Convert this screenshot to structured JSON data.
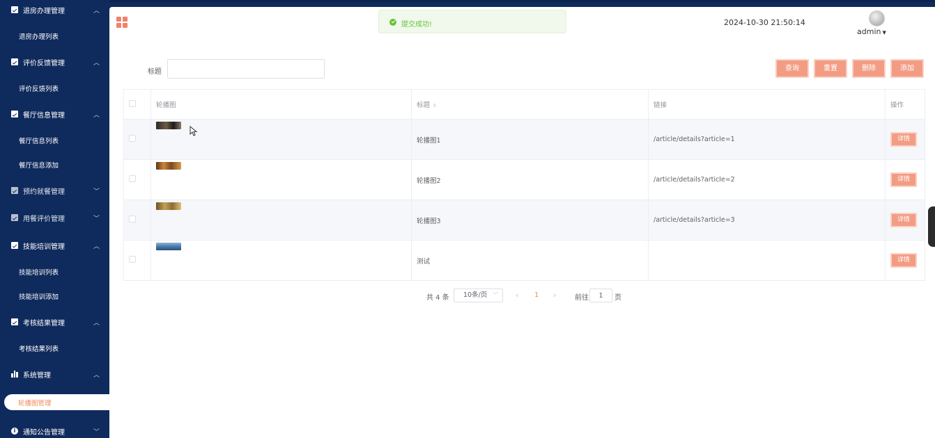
{
  "sidebar": {
    "groups": [
      {
        "label": "退房办理管理",
        "expanded": true,
        "sub": [
          "退房办理列表"
        ]
      },
      {
        "label": "评价反馈管理",
        "expanded": true,
        "sub": [
          "评价反馈列表"
        ]
      },
      {
        "label": "餐厅信息管理",
        "expanded": true,
        "sub": [
          "餐厅信息列表",
          "餐厅信息添加"
        ]
      },
      {
        "label": "预约就餐管理",
        "expanded": false
      },
      {
        "label": "用餐评价管理",
        "expanded": false
      },
      {
        "label": "技能培训管理",
        "expanded": true,
        "sub": [
          "技能培训列表",
          "技能培训添加"
        ]
      },
      {
        "label": "考核结果管理",
        "expanded": true,
        "sub": [
          "考核结果列表"
        ]
      },
      {
        "label": "系统管理",
        "expanded": true,
        "sub": [
          "轮播图管理"
        ]
      },
      {
        "label": "通知公告管理",
        "expanded": false
      }
    ],
    "active_item": "轮播图管理"
  },
  "header": {
    "toast": "提交成功!",
    "datetime": "2024-10-30 21:50:14",
    "user": "admin"
  },
  "search": {
    "label": "标题",
    "value": "",
    "placeholder": ""
  },
  "buttons": {
    "query": "查询",
    "reset": "重置",
    "delete": "删除",
    "add": "添加"
  },
  "table": {
    "columns": [
      "轮播图",
      "标题",
      "链接",
      "操作"
    ],
    "rows": [
      {
        "title": "轮播图1",
        "link": "/article/details?article=1",
        "action": "详情"
      },
      {
        "title": "轮播图2",
        "link": "/article/details?article=2",
        "action": "详情"
      },
      {
        "title": "轮播图3",
        "link": "/article/details?article=3",
        "action": "详情"
      },
      {
        "title": "测试",
        "link": "",
        "action": "详情"
      }
    ]
  },
  "pagination": {
    "total": "共 4 条",
    "page_size": "10条/页",
    "current_page": "1",
    "goto_label": "前往",
    "goto_value": "1",
    "page_suffix": "页"
  },
  "colors": {
    "sidebar_bg": "#0f2a5c",
    "accent": "#f39c84",
    "success": "#67c23a"
  }
}
